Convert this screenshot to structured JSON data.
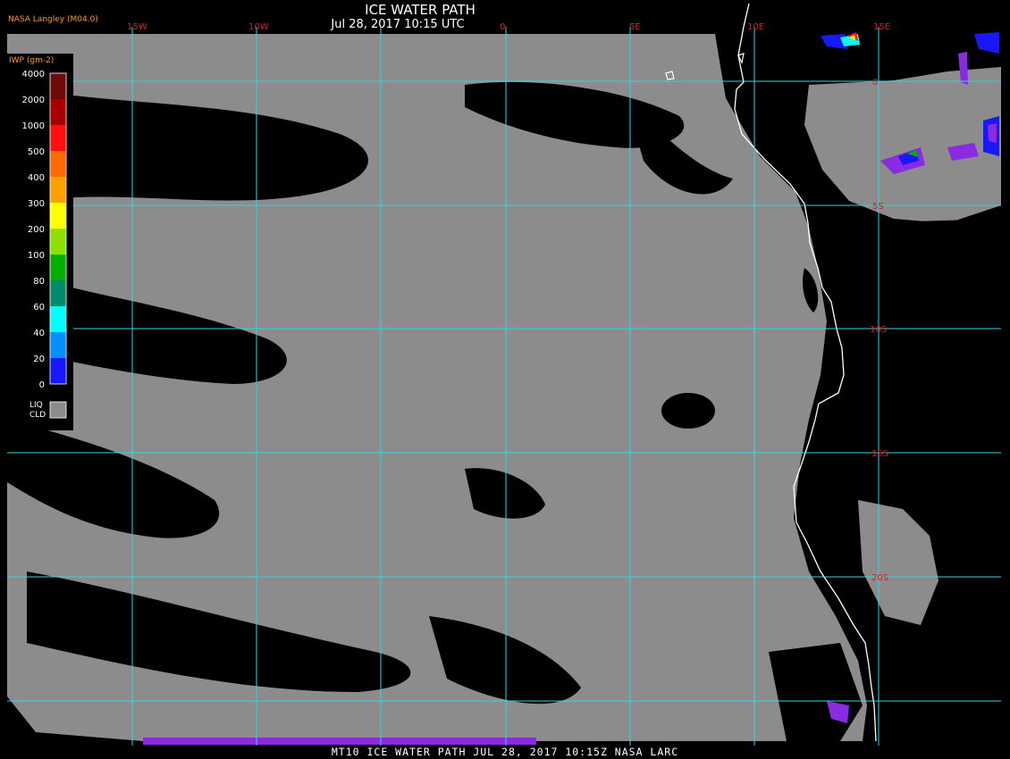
{
  "header": {
    "title": "ICE WATER PATH",
    "subtitle": "Jul 28, 2017 10:15 UTC",
    "credit": "NASA Langley (M04.0)"
  },
  "footer": {
    "text": "MT10  ICE WATER PATH  JUL 28, 2017 10:15Z  NASA LARC"
  },
  "legend": {
    "unit": "IWP (gm-2)",
    "levels": [
      {
        "label": "4000",
        "color": "#6e0a0a"
      },
      {
        "label": "2000",
        "color": "#a80000"
      },
      {
        "label": "1000",
        "color": "#ff1010"
      },
      {
        "label": "500",
        "color": "#ff6a00"
      },
      {
        "label": "400",
        "color": "#ffa000"
      },
      {
        "label": "300",
        "color": "#ffff00"
      },
      {
        "label": "200",
        "color": "#8ee000"
      },
      {
        "label": "100",
        "color": "#00b000"
      },
      {
        "label": "80",
        "color": "#008c6a"
      },
      {
        "label": "60",
        "color": "#00ffff"
      },
      {
        "label": "40",
        "color": "#0090ff"
      },
      {
        "label": "20",
        "color": "#1818ff"
      },
      {
        "label": "0",
        "color": "#8a2be2"
      }
    ],
    "liquid_cloud": {
      "label_top": "LIQ",
      "label_bottom": "CLD",
      "color": "#8c8c8c"
    }
  },
  "grid": {
    "color": "#2fd6e6",
    "lon_labels": [
      "15W",
      "10W",
      "0",
      "5E",
      "10E",
      "15E"
    ],
    "lat_labels": [
      "0",
      "5S",
      "10S",
      "15S",
      "20S"
    ]
  },
  "colors": {
    "clear_sky": "#000000",
    "liquid_cloud": "#8c8c8c",
    "coastline": "#ffffff",
    "label_red": "#d42020"
  }
}
